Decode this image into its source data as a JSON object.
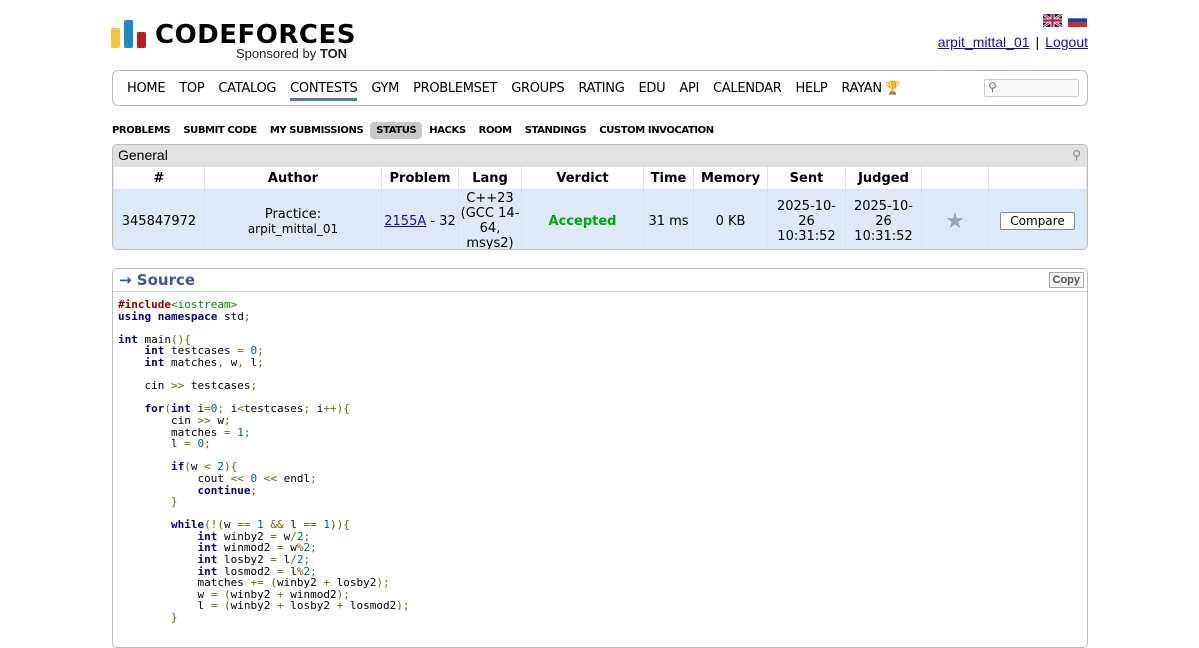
{
  "header": {
    "logo_text": "CODEFORCES",
    "sponsor_prefix": "Sponsored by",
    "sponsor_name": "TON",
    "username": "arpit_mittal_01",
    "separator": "|",
    "logout": "Logout",
    "flags": [
      "uk-flag-icon",
      "russia-flag-icon"
    ]
  },
  "menu": {
    "items": [
      "HOME",
      "TOP",
      "CATALOG",
      "CONTESTS",
      "GYM",
      "PROBLEMSET",
      "GROUPS",
      "RATING",
      "EDU",
      "API",
      "CALENDAR",
      "HELP",
      "RAYAN"
    ],
    "active": "CONTESTS",
    "search_placeholder": ""
  },
  "second_menu": {
    "items": [
      "PROBLEMS",
      "SUBMIT CODE",
      "MY SUBMISSIONS",
      "STATUS",
      "HACKS",
      "ROOM",
      "STANDINGS",
      "CUSTOM INVOCATION"
    ],
    "current": "STATUS"
  },
  "status": {
    "caption": "General",
    "headers": [
      "#",
      "Author",
      "Problem",
      "Lang",
      "Verdict",
      "Time",
      "Memory",
      "Sent",
      "Judged",
      "",
      ""
    ],
    "row": {
      "id": "345847972",
      "author_prefix": "Practice:",
      "author": "arpit_mittal_01",
      "problem_link": "2155A",
      "problem_suffix": " - 32",
      "lang": "C++23 (GCC 14-64, msys2)",
      "verdict": "Accepted",
      "time": "31 ms",
      "memory": "0 KB",
      "sent": "2025-10-26 10:31:52",
      "judged": "2025-10-26 10:31:52",
      "compare": "Compare"
    }
  },
  "source": {
    "title": "→ Source",
    "copy": "Copy",
    "code": [
      "#include<iostream>",
      "using namespace std;",
      "",
      "int main(){",
      "    int testcases = 0;",
      "    int matches, w, l;",
      "",
      "    cin >> testcases;",
      "",
      "    for(int i=0; i<testcases; i++){",
      "        cin >> w;",
      "        matches = 1;",
      "        l = 0;",
      "",
      "        if(w < 2){",
      "            cout << 0 << endl;",
      "            continue;",
      "        }",
      "",
      "        while(!(w == 1 && l == 1)){",
      "            int winby2 = w/2;",
      "            int winmod2 = w%2;",
      "            int losby2 = l/2;",
      "            int losmod2 = l%2;",
      "            matches += (winby2 + losby2);",
      "            w = (winby2 + winmod2);",
      "            l = (winby2 + losby2 + losmod2);",
      "        }"
    ]
  }
}
